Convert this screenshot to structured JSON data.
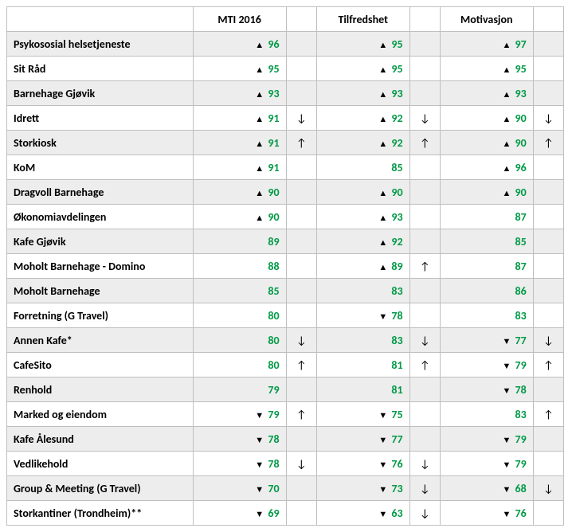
{
  "headers": {
    "name": "",
    "mti": "MTI 2016",
    "tilfredshet": "Tilfredshet",
    "motivasjon": "Motivasjon"
  },
  "glyphs": {
    "up_triangle": "▲",
    "down_triangle": "▼",
    "arrow_up": "↑",
    "arrow_down": "↓"
  },
  "rows": [
    {
      "name": "Psykososial helsetjeneste",
      "mti": {
        "value": 96,
        "tri": "up",
        "arrow": ""
      },
      "til": {
        "value": 95,
        "tri": "up",
        "arrow": ""
      },
      "mot": {
        "value": 97,
        "tri": "up",
        "arrow": ""
      }
    },
    {
      "name": "Sit Råd",
      "mti": {
        "value": 95,
        "tri": "up",
        "arrow": ""
      },
      "til": {
        "value": 95,
        "tri": "up",
        "arrow": ""
      },
      "mot": {
        "value": 95,
        "tri": "up",
        "arrow": ""
      }
    },
    {
      "name": "Barnehage Gjøvik",
      "mti": {
        "value": 93,
        "tri": "up",
        "arrow": ""
      },
      "til": {
        "value": 93,
        "tri": "up",
        "arrow": ""
      },
      "mot": {
        "value": 93,
        "tri": "up",
        "arrow": ""
      }
    },
    {
      "name": "Idrett",
      "mti": {
        "value": 91,
        "tri": "up",
        "arrow": "down"
      },
      "til": {
        "value": 92,
        "tri": "up",
        "arrow": "down"
      },
      "mot": {
        "value": 90,
        "tri": "up",
        "arrow": "down"
      }
    },
    {
      "name": "Storkiosk",
      "mti": {
        "value": 91,
        "tri": "up",
        "arrow": "up"
      },
      "til": {
        "value": 92,
        "tri": "up",
        "arrow": "up"
      },
      "mot": {
        "value": 90,
        "tri": "up",
        "arrow": "up"
      }
    },
    {
      "name": "KoM",
      "mti": {
        "value": 91,
        "tri": "up",
        "arrow": ""
      },
      "til": {
        "value": 85,
        "tri": "",
        "arrow": ""
      },
      "mot": {
        "value": 96,
        "tri": "up",
        "arrow": ""
      }
    },
    {
      "name": "Dragvoll Barnehage",
      "mti": {
        "value": 90,
        "tri": "up",
        "arrow": ""
      },
      "til": {
        "value": 90,
        "tri": "up",
        "arrow": ""
      },
      "mot": {
        "value": 90,
        "tri": "up",
        "arrow": ""
      }
    },
    {
      "name": "Økonomiavdelingen",
      "mti": {
        "value": 90,
        "tri": "up",
        "arrow": ""
      },
      "til": {
        "value": 93,
        "tri": "up",
        "arrow": ""
      },
      "mot": {
        "value": 87,
        "tri": "",
        "arrow": ""
      }
    },
    {
      "name": "Kafe Gjøvik",
      "mti": {
        "value": 89,
        "tri": "",
        "arrow": ""
      },
      "til": {
        "value": 92,
        "tri": "up",
        "arrow": ""
      },
      "mot": {
        "value": 85,
        "tri": "",
        "arrow": ""
      }
    },
    {
      "name": "Moholt Barnehage - Domino",
      "mti": {
        "value": 88,
        "tri": "",
        "arrow": ""
      },
      "til": {
        "value": 89,
        "tri": "up",
        "arrow": "up"
      },
      "mot": {
        "value": 87,
        "tri": "",
        "arrow": ""
      }
    },
    {
      "name": "Moholt Barnehage",
      "mti": {
        "value": 85,
        "tri": "",
        "arrow": ""
      },
      "til": {
        "value": 83,
        "tri": "",
        "arrow": ""
      },
      "mot": {
        "value": 86,
        "tri": "",
        "arrow": ""
      }
    },
    {
      "name": "Forretning (G Travel)",
      "mti": {
        "value": 80,
        "tri": "",
        "arrow": ""
      },
      "til": {
        "value": 78,
        "tri": "down",
        "arrow": ""
      },
      "mot": {
        "value": 83,
        "tri": "",
        "arrow": ""
      }
    },
    {
      "name": "Annen Kafe*",
      "mti": {
        "value": 80,
        "tri": "",
        "arrow": "down"
      },
      "til": {
        "value": 83,
        "tri": "",
        "arrow": "down"
      },
      "mot": {
        "value": 77,
        "tri": "down",
        "arrow": "down"
      }
    },
    {
      "name": "CafeSito",
      "mti": {
        "value": 80,
        "tri": "",
        "arrow": "up"
      },
      "til": {
        "value": 81,
        "tri": "",
        "arrow": "up"
      },
      "mot": {
        "value": 79,
        "tri": "down",
        "arrow": "up"
      }
    },
    {
      "name": "Renhold",
      "mti": {
        "value": 79,
        "tri": "",
        "arrow": ""
      },
      "til": {
        "value": 81,
        "tri": "",
        "arrow": ""
      },
      "mot": {
        "value": 78,
        "tri": "down",
        "arrow": ""
      }
    },
    {
      "name": "Marked og eiendom",
      "mti": {
        "value": 79,
        "tri": "down",
        "arrow": "up"
      },
      "til": {
        "value": 75,
        "tri": "down",
        "arrow": ""
      },
      "mot": {
        "value": 83,
        "tri": "",
        "arrow": "up"
      }
    },
    {
      "name": "Kafe Ålesund",
      "mti": {
        "value": 78,
        "tri": "down",
        "arrow": ""
      },
      "til": {
        "value": 77,
        "tri": "down",
        "arrow": ""
      },
      "mot": {
        "value": 79,
        "tri": "down",
        "arrow": ""
      }
    },
    {
      "name": "Vedlikehold",
      "mti": {
        "value": 78,
        "tri": "down",
        "arrow": "down"
      },
      "til": {
        "value": 76,
        "tri": "down",
        "arrow": "down"
      },
      "mot": {
        "value": 79,
        "tri": "down",
        "arrow": ""
      }
    },
    {
      "name": "Group & Meeting (G Travel)",
      "mti": {
        "value": 70,
        "tri": "down",
        "arrow": ""
      },
      "til": {
        "value": 73,
        "tri": "down",
        "arrow": "down"
      },
      "mot": {
        "value": 68,
        "tri": "down",
        "arrow": "down"
      }
    },
    {
      "name": "Storkantiner (Trondheim)**",
      "mti": {
        "value": 69,
        "tri": "down",
        "arrow": ""
      },
      "til": {
        "value": 63,
        "tri": "down",
        "arrow": "down"
      },
      "mot": {
        "value": 76,
        "tri": "down",
        "arrow": ""
      }
    }
  ]
}
